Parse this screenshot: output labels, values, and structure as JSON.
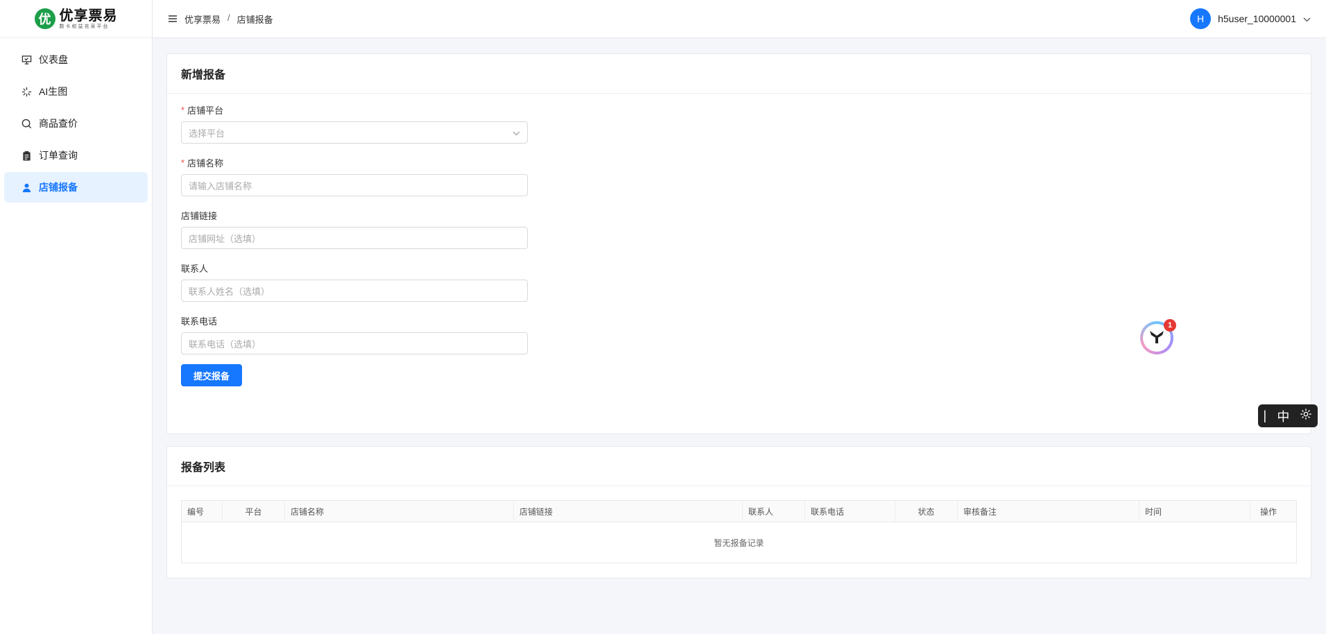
{
  "brand": {
    "logo_char": "优",
    "name": "优享票易",
    "tagline": "数卡权益充采平台"
  },
  "sidebar": {
    "items": [
      {
        "label": "仪表盘",
        "icon": "presentation-board-icon"
      },
      {
        "label": "AI生图",
        "icon": "loading-spark-icon"
      },
      {
        "label": "商品查价",
        "icon": "search-icon"
      },
      {
        "label": "订单查询",
        "icon": "clipboard-icon"
      },
      {
        "label": "店铺报备",
        "icon": "user-icon",
        "active": true
      }
    ]
  },
  "header": {
    "breadcrumb": [
      "优享票易",
      "店铺报备"
    ],
    "breadcrumb_sep": "/",
    "user": {
      "avatar_letter": "H",
      "name": "h5user_10000001"
    }
  },
  "form_card": {
    "title": "新增报备",
    "fields": {
      "platform": {
        "label": "店铺平台",
        "required": true,
        "placeholder": "选择平台"
      },
      "shop_name": {
        "label": "店铺名称",
        "required": true,
        "placeholder": "请输入店铺名称"
      },
      "shop_link": {
        "label": "店铺链接",
        "placeholder": "店铺网址（选填）"
      },
      "contact": {
        "label": "联系人",
        "placeholder": "联系人姓名（选填）"
      },
      "phone": {
        "label": "联系电话",
        "placeholder": "联系电话（选填）"
      }
    },
    "required_mark": "*",
    "submit_label": "提交报备"
  },
  "list_card": {
    "title": "报备列表",
    "columns": [
      "编号",
      "平台",
      "店铺名称",
      "店铺链接",
      "联系人",
      "联系电话",
      "状态",
      "审核备注",
      "时间",
      "操作"
    ],
    "empty_text": "暂无报备记录"
  },
  "widgets": {
    "assistant_badge": "1",
    "ime": {
      "cursor": "|",
      "lang": "中"
    }
  },
  "colors": {
    "primary": "#1677ff",
    "active_bg": "#e6f2ff",
    "logo_green": "#1e9e4a",
    "required": "#ff4d4f"
  }
}
